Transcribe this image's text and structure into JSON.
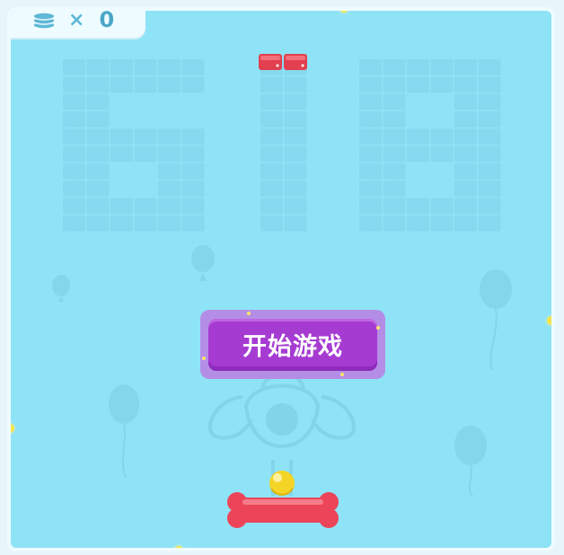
{
  "hud": {
    "multiplier_sign": "×",
    "coins": "0",
    "coin_icon": "coin-stack-icon"
  },
  "level_display": {
    "digits": "618",
    "brick_rows_remaining": 1
  },
  "bricks": [
    {
      "color": "#e2404f"
    },
    {
      "color": "#e2404f"
    }
  ],
  "start_button": {
    "label": "开始游戏",
    "color": "#a63bd2"
  },
  "paddle": {
    "shape": "bone",
    "color": "#ec4559"
  },
  "ball": {
    "color": "#f4d425"
  },
  "colors": {
    "board": "#8fe3f6",
    "frame": "#eefbff",
    "ghost_cell": "#86d9ee"
  }
}
